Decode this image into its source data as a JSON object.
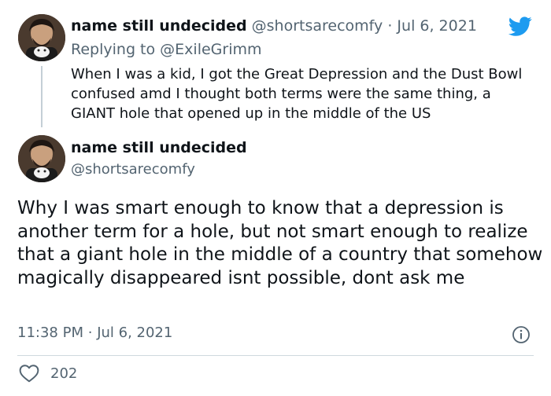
{
  "reply_tweet": {
    "display_name": "name still undecided",
    "handle": "@shortsarecomfy",
    "separator": "·",
    "date": "Jul 6, 2021",
    "replying_label": "Replying to",
    "replying_handle": "@ExileGrimm",
    "text": "When I was a kid, I got the Great Depression and the Dust Bowl confused amd I thought both terms were the same thing, a GIANT hole that opened up in the middle of the US"
  },
  "main_tweet": {
    "display_name": "name still undecided",
    "handle": "@shortsarecomfy",
    "text": "Why I was smart enough to know that a depression is another term for a hole, but not smart enough to realize that a giant hole in the middle of a country that somehow magically disappeared isnt possible, dont ask me",
    "time": "11:38 PM",
    "separator": "·",
    "date": "Jul 6, 2021",
    "like_count": "202"
  },
  "icons": {
    "logo": "twitter-bird-icon",
    "info": "info-icon",
    "like": "heart-icon"
  },
  "colors": {
    "brand_blue": "#1d9bf0",
    "muted_text": "#536471",
    "text": "#0f1419"
  }
}
